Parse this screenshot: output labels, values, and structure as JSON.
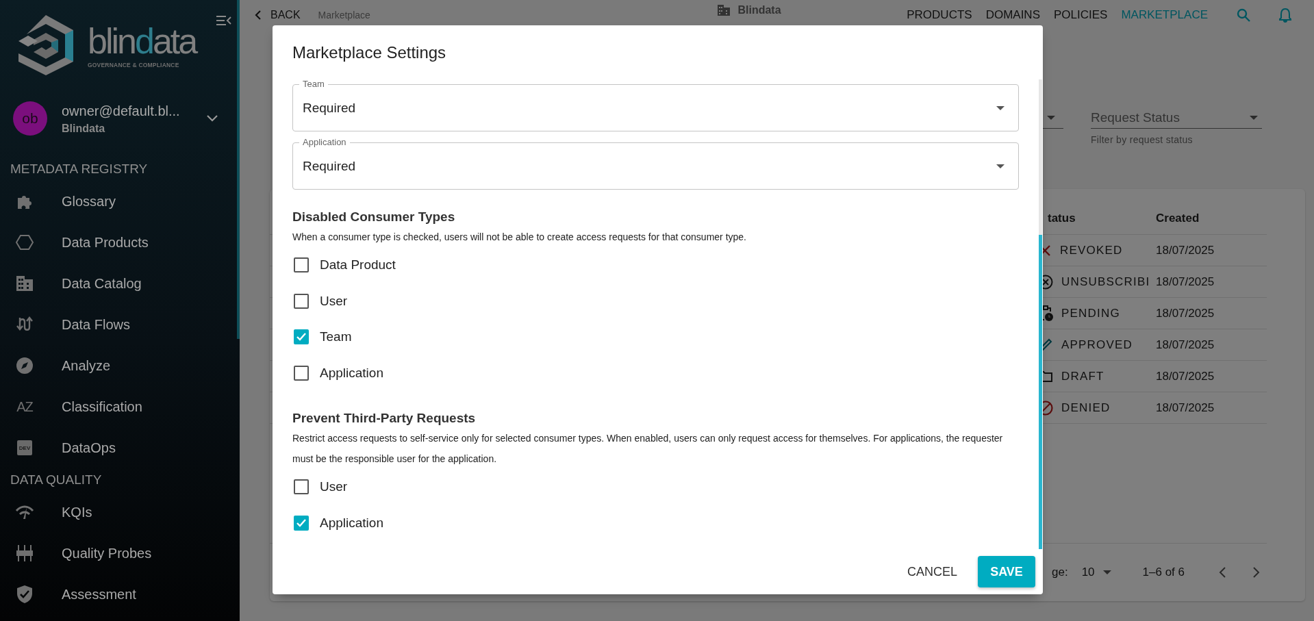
{
  "sidebar": {
    "wordmark": [
      {
        "text": "blin",
        "accent": false
      },
      {
        "text": "d",
        "accent": true
      },
      {
        "text": "ata",
        "accent": false
      }
    ],
    "tagline": "GOVERNANCE & COMPLIANCE",
    "user": {
      "initials": "ob",
      "email": "owner@default.bl...",
      "org": "Blindata"
    },
    "sections": [
      {
        "title": "METADATA REGISTRY",
        "items": [
          {
            "label": "Glossary",
            "kind": "glossary"
          },
          {
            "label": "Data Products",
            "kind": "products"
          },
          {
            "label": "Data Catalog",
            "kind": "catalog"
          },
          {
            "label": "Data Flows",
            "kind": "flows"
          },
          {
            "label": "Analyze",
            "kind": "analyze"
          },
          {
            "label": "Classification",
            "kind": "classification",
            "badge": "AZ"
          },
          {
            "label": "DataOps",
            "kind": "dataops",
            "badge": "DEV"
          }
        ]
      },
      {
        "title": "DATA QUALITY",
        "items": [
          {
            "label": "KQIs",
            "kind": "kqis"
          },
          {
            "label": "Quality Probes",
            "kind": "probes"
          },
          {
            "label": "Assessment",
            "kind": "assessment"
          }
        ]
      }
    ]
  },
  "header": {
    "back": "BACK",
    "breadcrumb": "Marketplace",
    "app_title": "Blindata",
    "nav": [
      {
        "label": "PRODUCTS",
        "selected": false
      },
      {
        "label": "DOMAINS",
        "selected": false
      },
      {
        "label": "POLICIES",
        "selected": false
      },
      {
        "label": "MARKETPLACE",
        "selected": true
      }
    ]
  },
  "filters": [
    {
      "label": "Request Status",
      "helper": "Filter by request status"
    }
  ],
  "table": {
    "columns": [
      "tatus",
      "Created"
    ],
    "rows": [
      {
        "status": "REVOKED",
        "kind": "revoked",
        "created": "18/07/2025"
      },
      {
        "status": "UNSUBSCRIBI",
        "kind": "unsubscribed",
        "created": "18/07/2025"
      },
      {
        "status": "PENDING",
        "kind": "pending",
        "created": "18/07/2025"
      },
      {
        "status": "APPROVED",
        "kind": "approved",
        "created": "18/07/2025"
      },
      {
        "status": "DRAFT",
        "kind": "draft",
        "created": "18/07/2025"
      },
      {
        "status": "DENIED",
        "kind": "denied",
        "created": "18/07/2025"
      }
    ],
    "footer": {
      "rows_label": "ge:",
      "rows_value": "10",
      "range": "1–6 of 6"
    }
  },
  "dialog": {
    "title": "Marketplace Settings",
    "selects": [
      {
        "label": "Team",
        "value": "Required"
      },
      {
        "label": "Application",
        "value": "Required"
      }
    ],
    "sections": [
      {
        "title": "Disabled Consumer Types",
        "description": "When a consumer type is checked, users will not be able to create access requests for that consumer type.",
        "options": [
          {
            "label": "Data Product",
            "checked": false
          },
          {
            "label": "User",
            "checked": false
          },
          {
            "label": "Team",
            "checked": true
          },
          {
            "label": "Application",
            "checked": false
          }
        ]
      },
      {
        "title": "Prevent Third-Party Requests",
        "description": "Restrict access requests to self-service only for selected consumer types. When enabled, users can only request access for themselves. For applications, the requester must be the responsible user for the application.",
        "options": [
          {
            "label": "User",
            "checked": false
          },
          {
            "label": "Application",
            "checked": true
          }
        ]
      }
    ],
    "actions": [
      {
        "label": "CANCEL",
        "kind": "text"
      },
      {
        "label": "SAVE",
        "kind": "primary"
      }
    ]
  }
}
